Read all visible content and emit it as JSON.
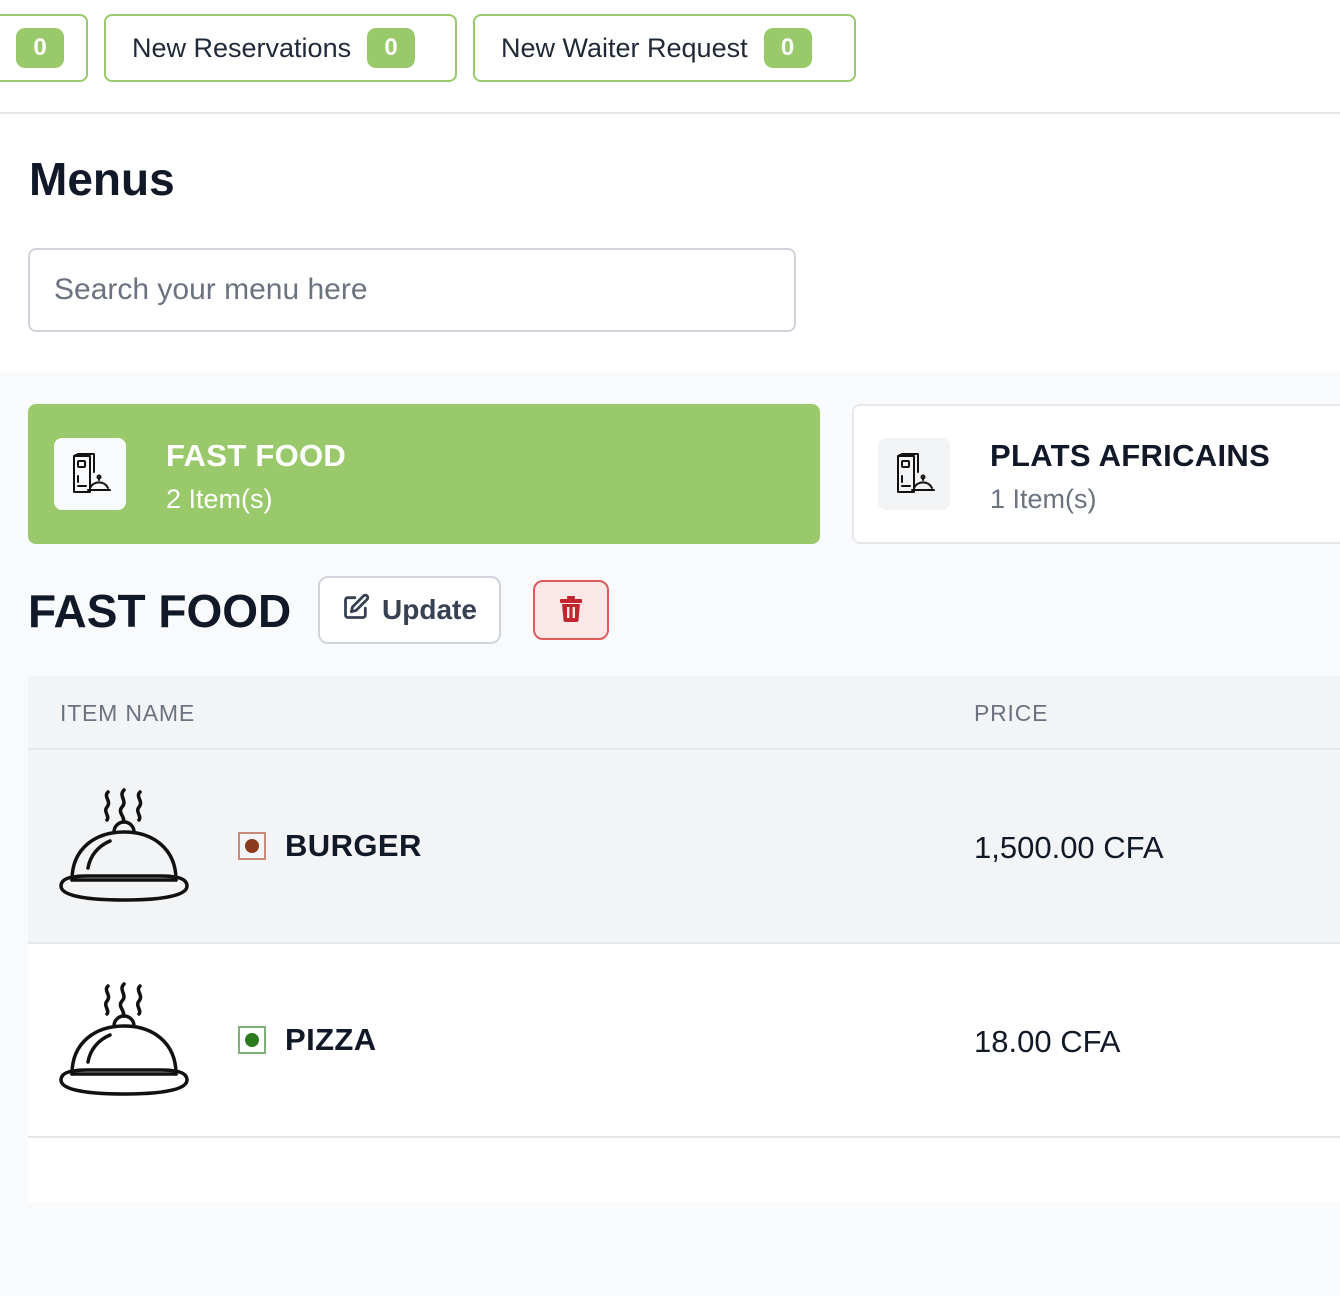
{
  "notifications": [
    {
      "label": "",
      "count": "0"
    },
    {
      "label": "New Reservations",
      "count": "0"
    },
    {
      "label": "New Waiter Request",
      "count": "0"
    }
  ],
  "page": {
    "title": "Menus",
    "search_placeholder": "Search your menu here"
  },
  "categories": [
    {
      "name": "FAST FOOD",
      "count_label": "2 Item(s)",
      "active": true
    },
    {
      "name": "PLATS AFRICAINS",
      "count_label": "1 Item(s)",
      "active": false
    }
  ],
  "section": {
    "title": "FAST FOOD",
    "update_label": "Update",
    "update_icon": "edit-icon",
    "delete_icon": "trash-icon"
  },
  "table": {
    "headers": {
      "name": "ITEM NAME",
      "price": "PRICE"
    },
    "rows": [
      {
        "name": "BURGER",
        "price": "1,500.00 CFA",
        "type_color": "#8b3a1e",
        "icon": "cloche-icon"
      },
      {
        "name": "PIZZA",
        "price": "18.00 CFA",
        "type_color": "#2d7a1f",
        "icon": "cloche-icon"
      }
    ]
  },
  "colors": {
    "accent": "#99c96b",
    "danger": "#c0262d",
    "danger_bg": "#fde8e8"
  }
}
